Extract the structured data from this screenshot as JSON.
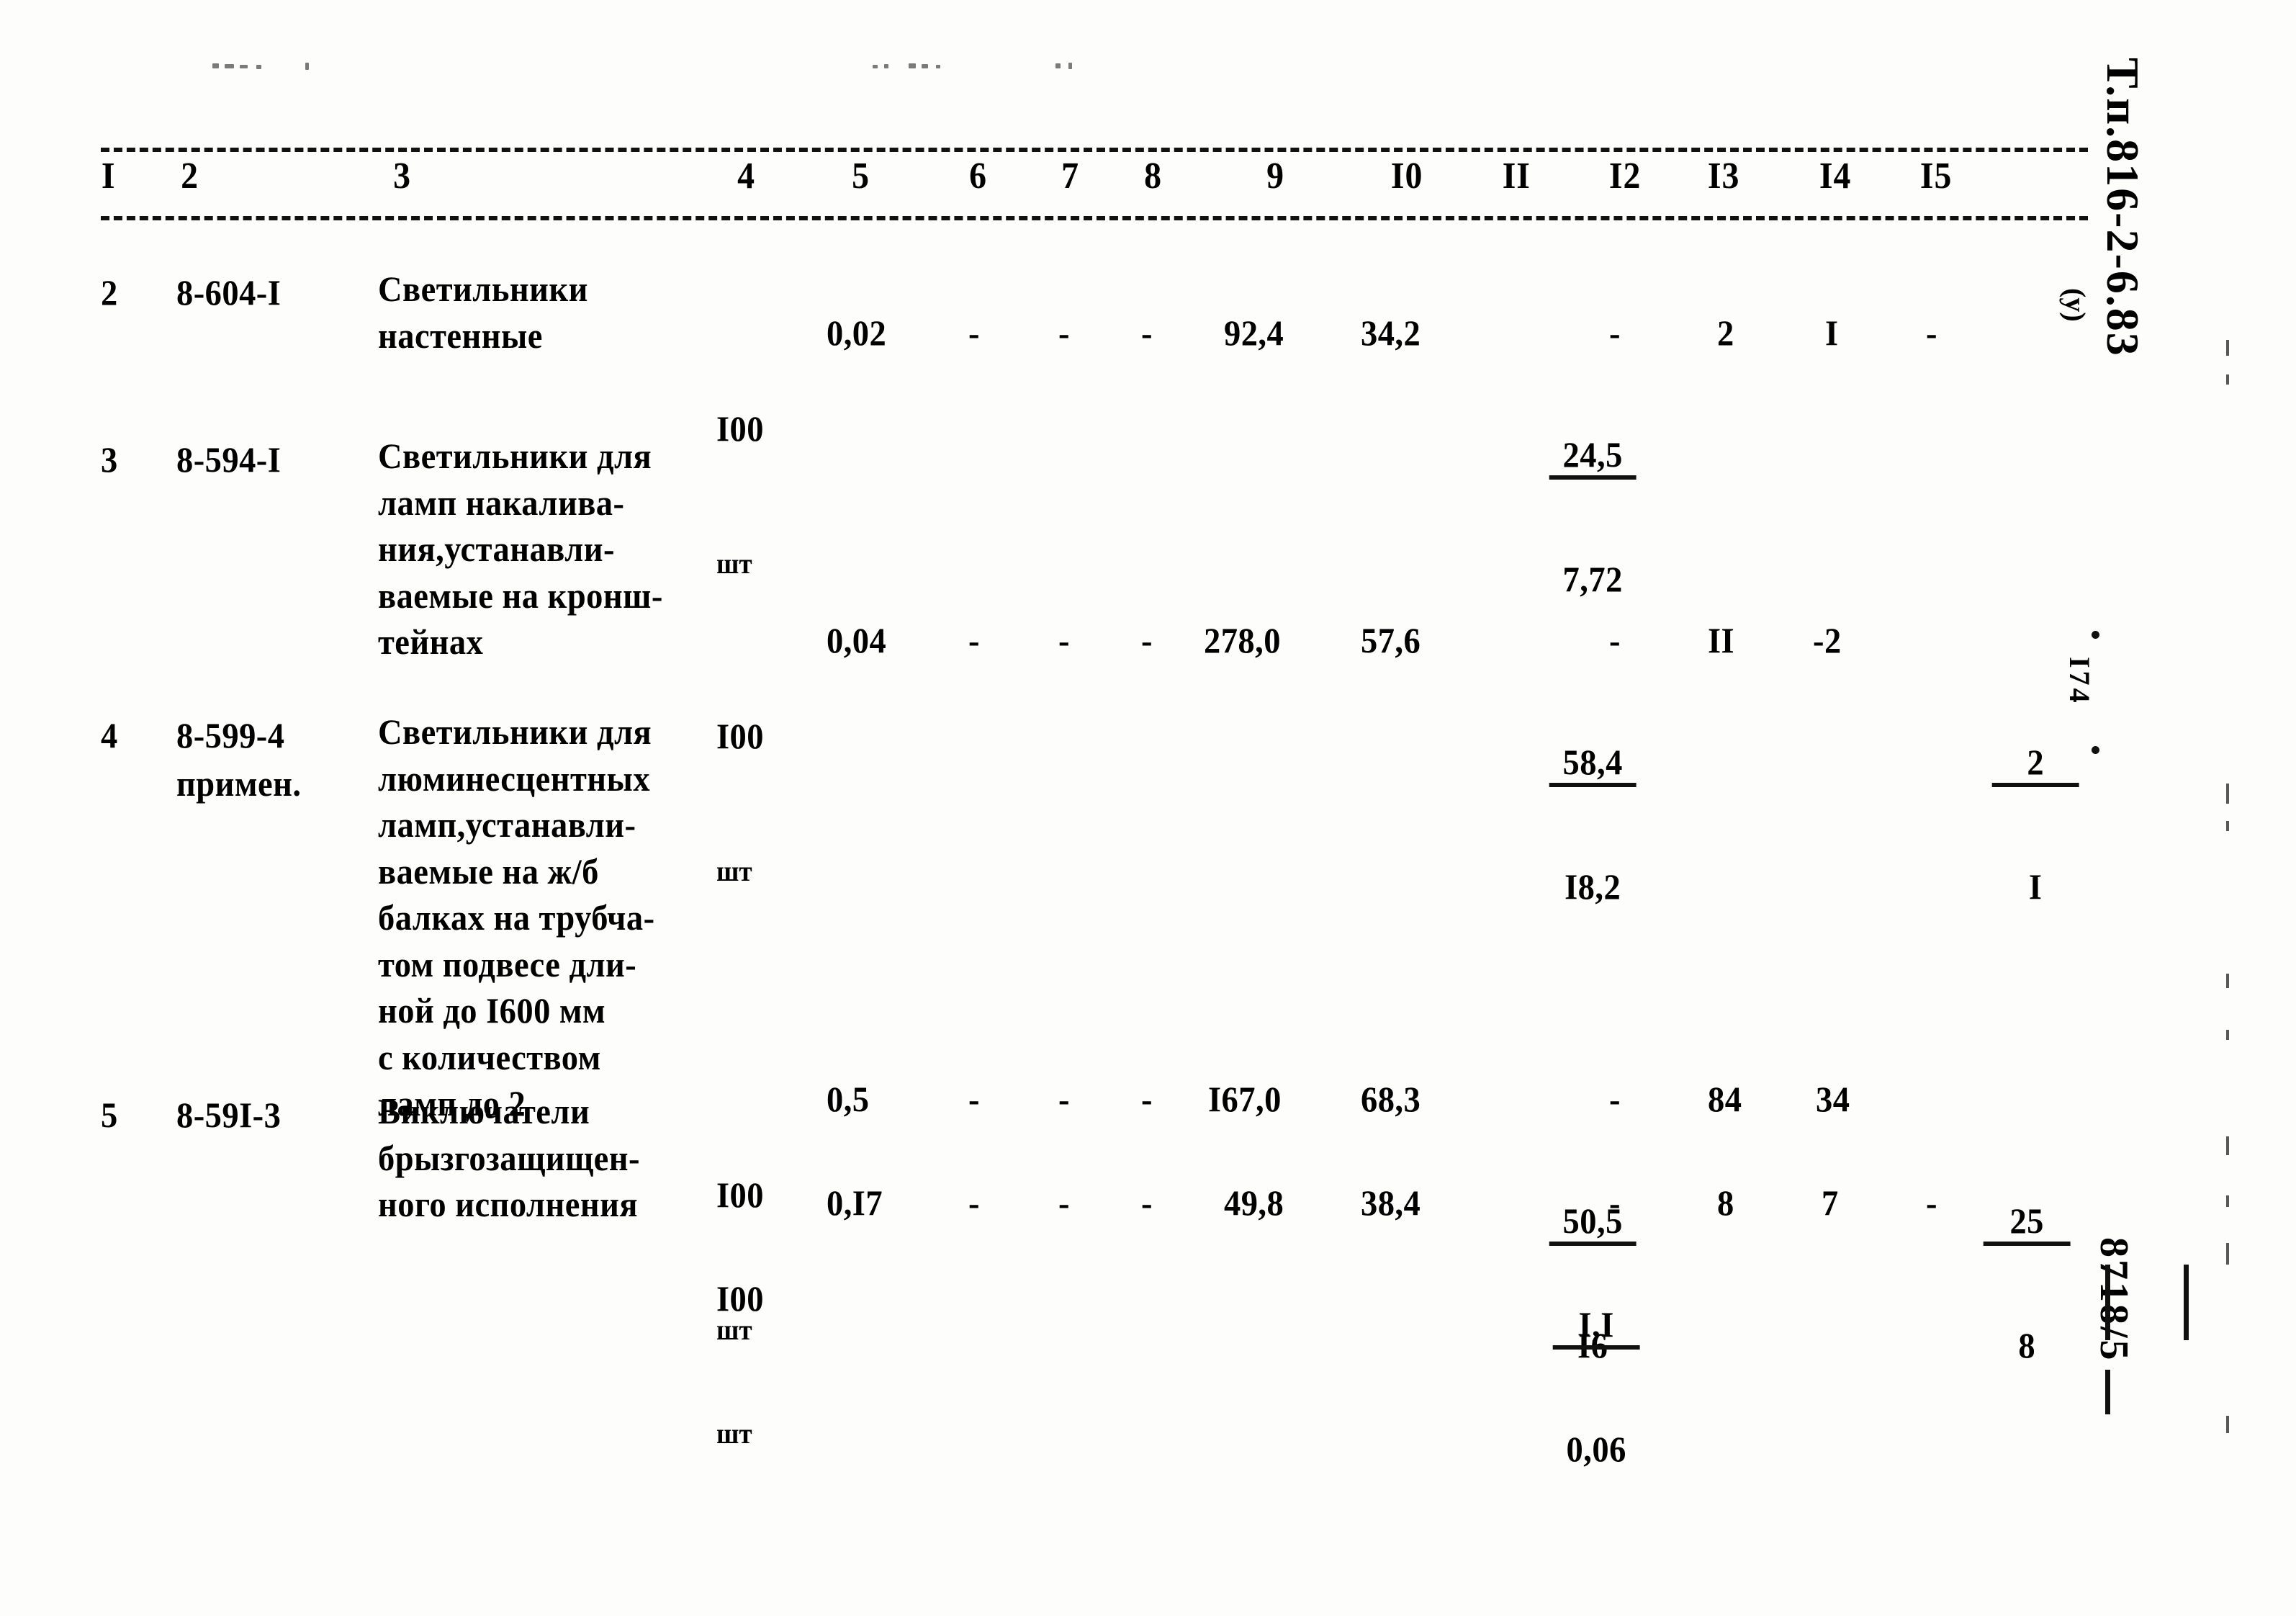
{
  "document": {
    "type": "scanned-technical-table",
    "language": "ru"
  },
  "margin_stamps": {
    "code": "Т.п.816-2-6.83",
    "code_suffix": "(у)",
    "page_number": "I74",
    "doc_number": "8718/5"
  },
  "table": {
    "column_headers": [
      "I",
      "2",
      "3",
      "4",
      "5",
      "6",
      "7",
      "8",
      "9",
      "I0",
      "II",
      "I2",
      "I3",
      "I4",
      "I5"
    ],
    "rows": [
      {
        "c1": "2",
        "c2": "8-604-I",
        "c3": "Светильники\nнастенные",
        "c4_main": "I00",
        "c4_sub": "шт",
        "c5": "0,02",
        "c6": "-",
        "c7": "-",
        "c8": "-",
        "c9": "92,4",
        "c10": "34,2",
        "c11_num": "24,5",
        "c11_den": "7,72",
        "c12": "-",
        "c13": "2",
        "c14": "I",
        "c15": "-",
        "c15_num": "",
        "c15_den": ""
      },
      {
        "c1": "3",
        "c2": "8-594-I",
        "c3": "Светильники для\nламп накалива-\nния,устанавли-\nваемые на кронш-\nтейнах",
        "c4_main": "I00",
        "c4_sub": "шт",
        "c5": "0,04",
        "c6": "-",
        "c7": "-",
        "c8": "-",
        "c9": "278,0",
        "c10": "57,6",
        "c11_num": "58,4",
        "c11_den": "I8,2",
        "c12": "-",
        "c13": "II",
        "c14": "-2",
        "c15": "",
        "c15_num": "2",
        "c15_den": "I"
      },
      {
        "c1": "4",
        "c2": "8-599-4\nпримен.",
        "c3": "Светильники для\nлюминесцентных\nламп,устанавли-\nваемые на ж/б\nбалках на трубча-\nтом подвесе дли-\nной до I600 мм\nс количеством\nламп до 2",
        "c4_main": "I00",
        "c4_sub": "шт",
        "c5": "0,5",
        "c6": "-",
        "c7": "-",
        "c8": "-",
        "c9": "I67,0",
        "c10": "68,3",
        "c11_num": "50,5",
        "c11_den": "I6",
        "c12": "-",
        "c13": "84",
        "c14": "34",
        "c15": "",
        "c15_num": "25",
        "c15_den": "8"
      },
      {
        "c1": "5",
        "c2": "8-59I-3",
        "c3": "Виключатели\nбрызгозащищен-\nного исполнения",
        "c4_main": "I00",
        "c4_sub": "шт",
        "c5": "0,I7",
        "c6": "-",
        "c7": "-",
        "c8": "-",
        "c9": "49,8",
        "c10": "38,4",
        "c11_num": "I,I",
        "c11_den": "0,06",
        "c12": "-",
        "c13": "8",
        "c14": "7",
        "c15": "-",
        "c15_num": "",
        "c15_den": ""
      }
    ]
  }
}
